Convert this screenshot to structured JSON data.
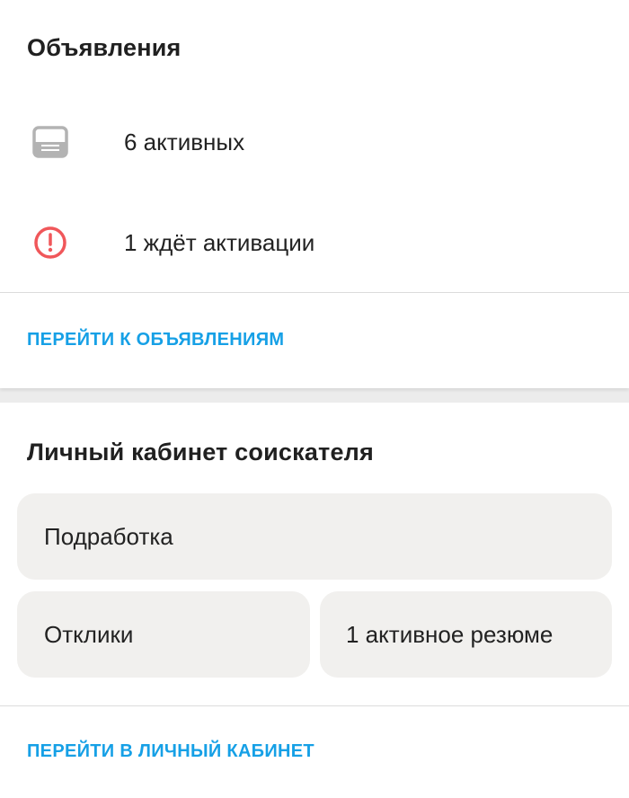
{
  "ads": {
    "title": "Объявления",
    "items": [
      {
        "icon": "ads-list-icon",
        "label": "6 активных"
      },
      {
        "icon": "alert-icon",
        "label": "1 ждёт активации"
      }
    ],
    "link_label": "ПЕРЕЙТИ К ОБЪЯВЛЕНИЯМ"
  },
  "seeker": {
    "title": "Личный кабинет соискателя",
    "tiles": [
      {
        "label": "Подработка"
      },
      {
        "label": "Отклики"
      },
      {
        "label": "1 активное резюме"
      }
    ],
    "link_label": "ПЕРЕЙТИ В ЛИЧНЫЙ КАБИНЕТ"
  },
  "colors": {
    "accent": "#16a0e6",
    "alert": "#f0575a",
    "icon_gray": "#b3b3b3",
    "tile_bg": "#f1f0ee",
    "page_bg": "#ececec"
  }
}
